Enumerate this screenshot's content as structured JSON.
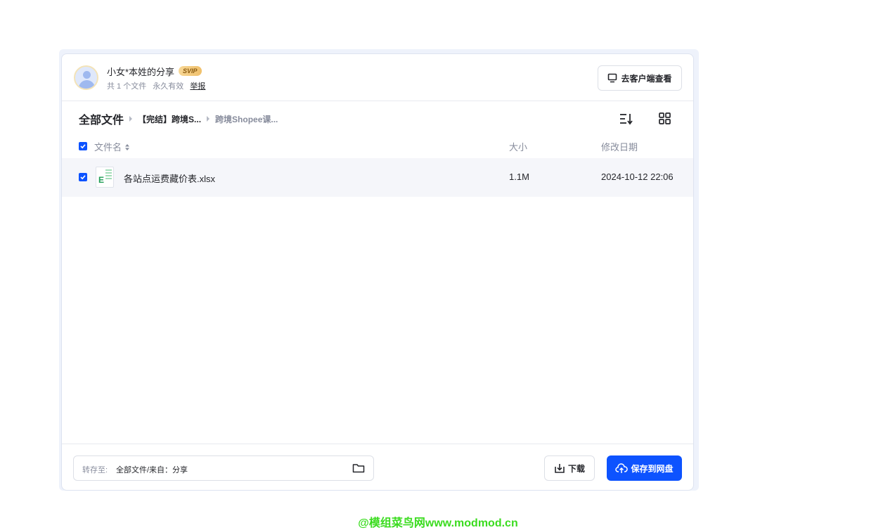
{
  "share": {
    "title": "小女*本姓的分享",
    "badge": "SVIP",
    "file_count": "共 1 个文件",
    "validity": "永久有效",
    "report": "举报",
    "client_button": "去客户端查看"
  },
  "breadcrumb": {
    "root": "全部文件",
    "mid": "【完结】跨境S...",
    "last": "跨境Shopee课..."
  },
  "table": {
    "headers": {
      "name": "文件名",
      "size": "大小",
      "date": "修改日期"
    },
    "rows": [
      {
        "name": "各站点运费藏价表.xlsx",
        "size": "1.1M",
        "date": "2024-10-12 22:06",
        "icon": "excel-file-icon"
      }
    ]
  },
  "footer": {
    "save_to_label": "转存至:",
    "save_to_value": "全部文件/来自：分享",
    "download": "下载",
    "save": "保存到网盘"
  },
  "watermark": "@模组菜鸟网www.modmod.cn",
  "colors": {
    "primary": "#0d53ff",
    "watermark": "#3bdc1f",
    "row_bg": "#f5f6fa"
  }
}
